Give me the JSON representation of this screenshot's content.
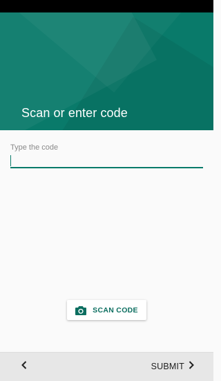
{
  "header": {
    "title": "Scan or enter code"
  },
  "code_field": {
    "label": "Type the code",
    "value": ""
  },
  "scan_button": {
    "label": "SCAN CODE",
    "icon": "camera-icon"
  },
  "footer": {
    "back_icon": "chevron-left-icon",
    "submit_label": "SUBMIT",
    "submit_icon": "chevron-right-icon"
  },
  "colors": {
    "accent": "#097a6a",
    "status_bar": "#000000",
    "footer": "#e7e7e7"
  }
}
